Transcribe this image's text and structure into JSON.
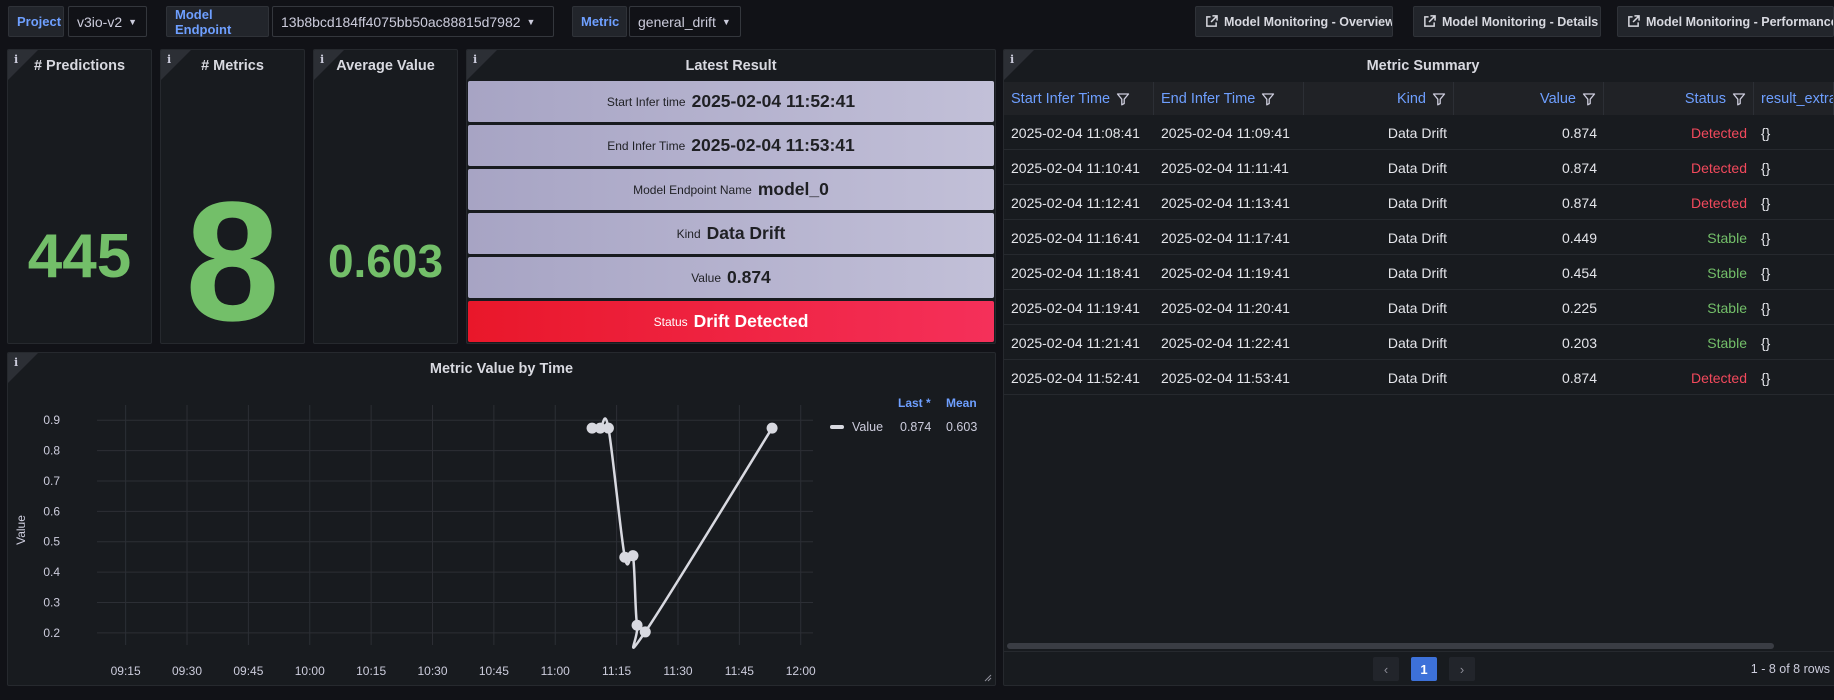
{
  "topbar": {
    "project": {
      "label": "Project",
      "value": "v3io-v2"
    },
    "endpoint": {
      "label": "Model Endpoint",
      "value": "13b8bcd184ff4075bb50ac88815d7982"
    },
    "metric": {
      "label": "Metric",
      "value": "general_drift"
    },
    "links": [
      {
        "label": "Model Monitoring - Overview",
        "icon": "external-link-icon"
      },
      {
        "label": "Model Monitoring - Details",
        "icon": "external-link-icon"
      },
      {
        "label": "Model Monitoring - Performance",
        "icon": "external-link-icon"
      }
    ]
  },
  "stats": {
    "predictions": {
      "title": "# Predictions",
      "value": "445"
    },
    "metrics": {
      "title": "# Metrics",
      "value": "8"
    },
    "average": {
      "title": "Average Value",
      "value": "0.603"
    }
  },
  "latest_result": {
    "title": "Latest Result",
    "rows": [
      {
        "key": "Start Infer time",
        "value": "2025-02-04 11:52:41"
      },
      {
        "key": "End Infer Time",
        "value": "2025-02-04 11:53:41"
      },
      {
        "key": "Model Endpoint Name",
        "value": "model_0"
      },
      {
        "key": "Kind",
        "value": "Data Drift"
      },
      {
        "key": "Value",
        "value": "0.874"
      },
      {
        "key": "Status",
        "value": "Drift Detected"
      }
    ]
  },
  "chart_panel": {
    "title": "Metric Value by Time",
    "legend": {
      "col_last": "Last *",
      "col_mean": "Mean",
      "series_name": "Value",
      "last": "0.874",
      "mean": "0.603"
    }
  },
  "chart_data": {
    "type": "line",
    "title": "Metric Value by Time",
    "ylabel": "Value",
    "xlabel": "",
    "x_ticks": [
      "09:15",
      "09:30",
      "09:45",
      "10:00",
      "10:15",
      "10:30",
      "10:45",
      "11:00",
      "11:15",
      "11:30",
      "11:45",
      "12:00"
    ],
    "y_ticks": [
      "0.9",
      "0.8",
      "0.7",
      "0.6",
      "0.5",
      "0.4",
      "0.3",
      "0.2"
    ],
    "xlim": [
      "09:08",
      "12:03"
    ],
    "ylim": [
      0.16,
      0.95
    ],
    "series": [
      {
        "name": "Value",
        "color": "#d8d9e0",
        "x": [
          "11:09",
          "11:11",
          "11:13",
          "11:17",
          "11:19",
          "11:20",
          "11:22",
          "11:53"
        ],
        "values": [
          0.874,
          0.874,
          0.874,
          0.449,
          0.454,
          0.225,
          0.203,
          0.874
        ]
      }
    ],
    "grid": true,
    "legend": "right"
  },
  "table": {
    "title": "Metric Summary",
    "columns": [
      "Start Infer Time",
      "End Infer Time",
      "Kind",
      "Value",
      "Status",
      "result_extra"
    ],
    "rows": [
      [
        "2025-02-04 11:08:41",
        "2025-02-04 11:09:41",
        "Data Drift",
        "0.874",
        "Detected",
        "{}"
      ],
      [
        "2025-02-04 11:10:41",
        "2025-02-04 11:11:41",
        "Data Drift",
        "0.874",
        "Detected",
        "{}"
      ],
      [
        "2025-02-04 11:12:41",
        "2025-02-04 11:13:41",
        "Data Drift",
        "0.874",
        "Detected",
        "{}"
      ],
      [
        "2025-02-04 11:16:41",
        "2025-02-04 11:17:41",
        "Data Drift",
        "0.449",
        "Stable",
        "{}"
      ],
      [
        "2025-02-04 11:18:41",
        "2025-02-04 11:19:41",
        "Data Drift",
        "0.454",
        "Stable",
        "{}"
      ],
      [
        "2025-02-04 11:19:41",
        "2025-02-04 11:20:41",
        "Data Drift",
        "0.225",
        "Stable",
        "{}"
      ],
      [
        "2025-02-04 11:21:41",
        "2025-02-04 11:22:41",
        "Data Drift",
        "0.203",
        "Stable",
        "{}"
      ],
      [
        "2025-02-04 11:52:41",
        "2025-02-04 11:53:41",
        "Data Drift",
        "0.874",
        "Detected",
        "{}"
      ]
    ],
    "pagination": {
      "current_page": "1",
      "summary": "1 - 8 of 8 rows"
    }
  },
  "colors": {
    "stat_green": "#73bf69",
    "detected_red": "#f2495c",
    "stable_green": "#73bf69",
    "accent_blue": "#6e9fff",
    "status_bg": "#e9172a"
  }
}
